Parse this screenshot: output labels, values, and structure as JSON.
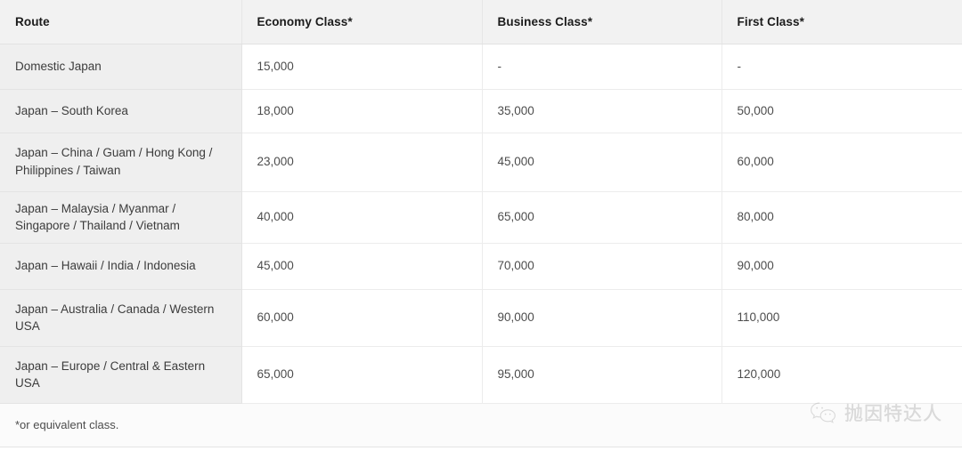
{
  "table": {
    "columns": [
      {
        "key": "route",
        "label": "Route"
      },
      {
        "key": "economy",
        "label": "Economy Class*"
      },
      {
        "key": "business",
        "label": "Business Class*"
      },
      {
        "key": "first",
        "label": "First Class*"
      }
    ],
    "rows": [
      {
        "route": "Domestic Japan",
        "economy": "15,000",
        "business": "-",
        "first": "-"
      },
      {
        "route": "Japan – South Korea",
        "economy": "18,000",
        "business": "35,000",
        "first": "50,000"
      },
      {
        "route": "Japan – China / Guam / Hong Kong / Philippines / Taiwan",
        "economy": "23,000",
        "business": "45,000",
        "first": "60,000"
      },
      {
        "route": "Japan – Malaysia / Myanmar / Singapore / Thailand / Vietnam",
        "economy": "40,000",
        "business": "65,000",
        "first": "80,000"
      },
      {
        "route": "Japan – Hawaii / India / Indonesia",
        "economy": "45,000",
        "business": "70,000",
        "first": "90,000"
      },
      {
        "route": "Japan – Australia / Canada / Western USA",
        "economy": "60,000",
        "business": "90,000",
        "first": "110,000"
      },
      {
        "route": "Japan – Europe / Central & Eastern USA",
        "economy": "65,000",
        "business": "95,000",
        "first": "120,000"
      }
    ],
    "footnote": "*or equivalent class."
  },
  "watermark": {
    "text": "抛因特达人",
    "logo": "wechat-icon"
  },
  "colors": {
    "header_background": "#f2f2f2",
    "route_column_background": "#efefef",
    "cell_background": "#ffffff",
    "border": "#ececec",
    "header_text": "#1b1b1b",
    "cell_text": "#4d4d4d"
  }
}
